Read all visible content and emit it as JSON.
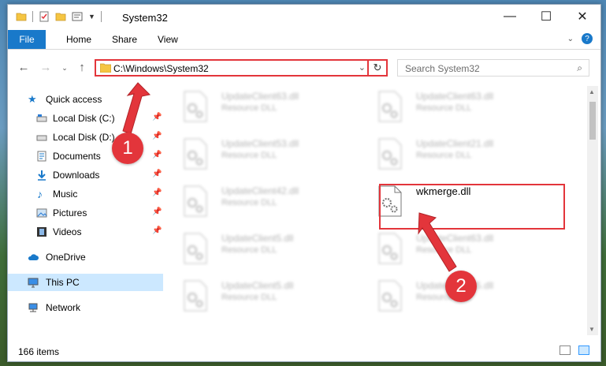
{
  "window": {
    "title": "System32"
  },
  "ribbon": {
    "tabs": [
      {
        "label": "File"
      },
      {
        "label": "Home"
      },
      {
        "label": "Share"
      },
      {
        "label": "View"
      }
    ]
  },
  "window_controls": {
    "minimize": "—",
    "maximize": "☐",
    "close": "✕"
  },
  "address": {
    "path": "C:\\Windows\\System32"
  },
  "search": {
    "placeholder": "Search System32"
  },
  "nav": {
    "items": [
      {
        "label": "Quick access"
      },
      {
        "label": "Local Disk (C:)"
      },
      {
        "label": "Local Disk (D:)"
      },
      {
        "label": "Documents"
      },
      {
        "label": "Downloads"
      },
      {
        "label": "Music"
      },
      {
        "label": "Pictures"
      },
      {
        "label": "Videos"
      },
      {
        "label": "OneDrive"
      },
      {
        "label": "This PC"
      },
      {
        "label": "Network"
      }
    ]
  },
  "files": [
    {
      "name": "UpdateClient63.dll",
      "desc": "Resource DLL"
    },
    {
      "name": "UpdateClient63.dll",
      "desc": "Resource DLL"
    },
    {
      "name": "UpdateClient53.dll",
      "desc": "Resource DLL"
    },
    {
      "name": "UpdateClient21.dll",
      "desc": "Resource DLL"
    },
    {
      "name": "UpdateClient42.dll",
      "desc": "Resource DLL"
    },
    {
      "name": "wkmerge.dll",
      "desc": ""
    },
    {
      "name": "UpdateClient5.dll",
      "desc": "Resource DLL"
    },
    {
      "name": "UpdateClient63.dll",
      "desc": "Resource DLL"
    },
    {
      "name": "UpdateClient5.dll",
      "desc": "Resource DLL"
    },
    {
      "name": "UpdateClient65.dll",
      "desc": "Resource DLL"
    }
  ],
  "status": {
    "count": "166 items"
  },
  "annotations": {
    "step1": "1",
    "step2": "2"
  },
  "colors": {
    "accent": "#1979ca",
    "highlight": "#e3353b",
    "selected": "#cce8ff"
  }
}
